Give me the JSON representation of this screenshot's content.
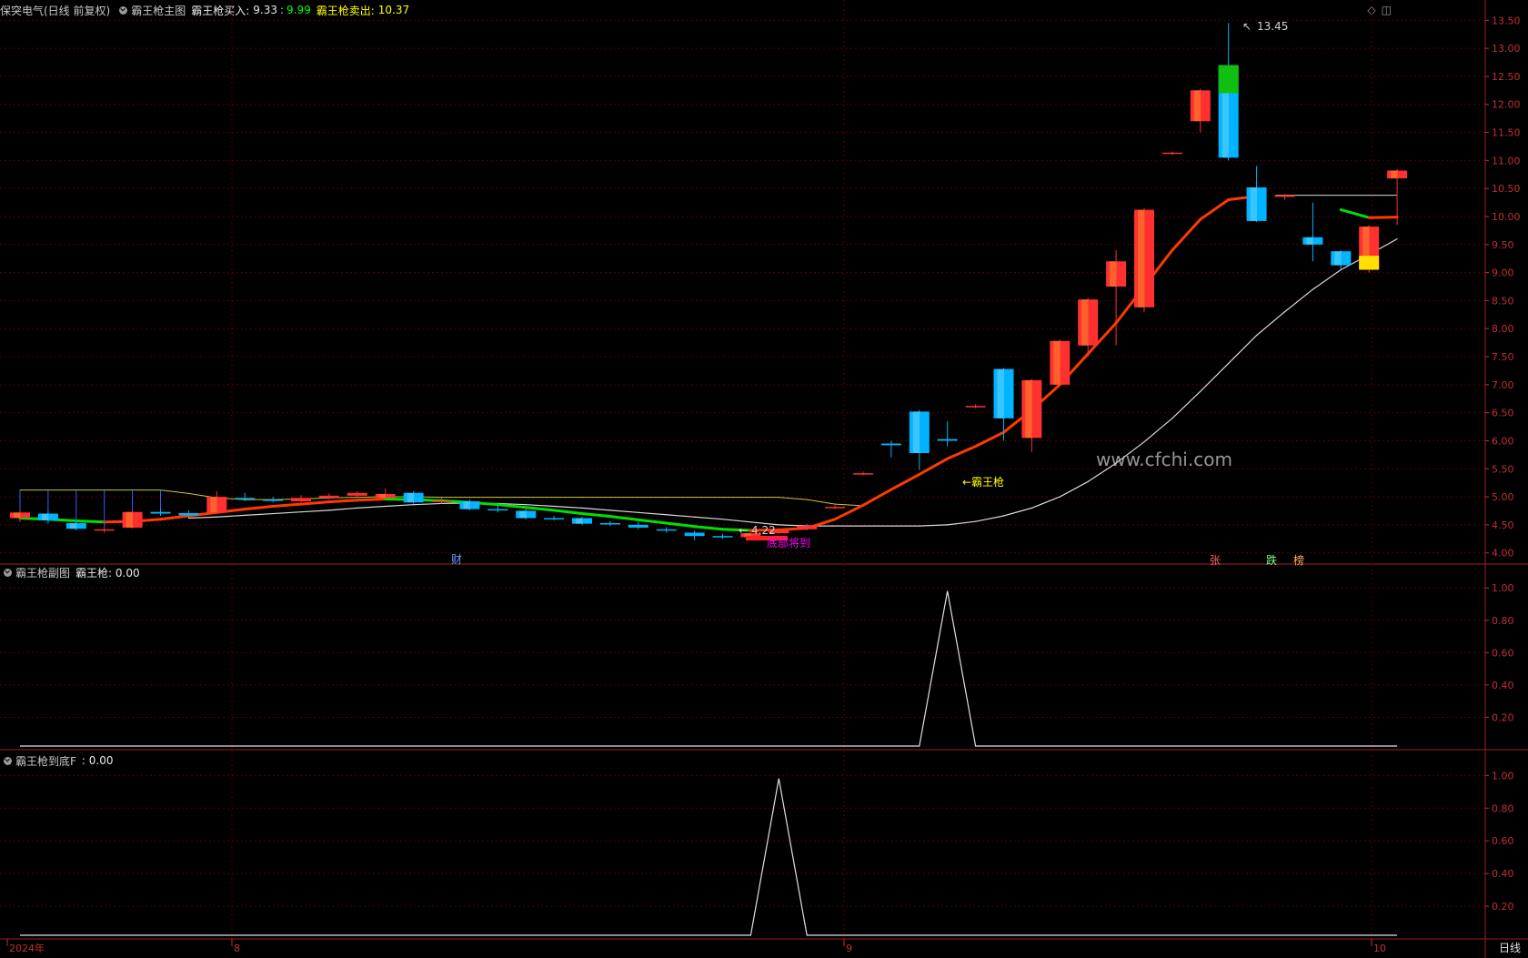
{
  "header": {
    "stock": "保突电气(日线 前复权)",
    "main_indicator": "霸王枪主图",
    "buy_label": "霸王枪买入:",
    "buy_value1": "9.33",
    "buy_value2": "9.99",
    "sell_label": "霸王枪卖出:",
    "sell_value": "10.37"
  },
  "panel2": {
    "indicator": "霸王枪副图",
    "value_label": "霸王枪: 0.00"
  },
  "panel3": {
    "indicator": "霸王枪到底F",
    "value_label": ": 0.00"
  },
  "watermark": "www.cfchi.com",
  "annotations": {
    "peak": "13.45",
    "low": "4.22",
    "bawangqiang": "←霸王枪",
    "bottom_signal": "底部将到",
    "cai": "财",
    "zhang": "张",
    "die": "跌",
    "bang": "榜"
  },
  "price_axis": [
    "13.50",
    "13.00",
    "12.50",
    "12.00",
    "11.50",
    "11.00",
    "10.50",
    "10.00",
    "9.50",
    "9.00",
    "8.50",
    "8.00",
    "7.50",
    "7.00",
    "6.50",
    "6.00",
    "5.50",
    "5.00",
    "4.50",
    "4.00"
  ],
  "sub_axis": [
    "1.00",
    "0.80",
    "0.60",
    "0.40",
    "0.20"
  ],
  "date_axis": [
    "2024年",
    "8",
    "9",
    "10"
  ],
  "period_button": "日线",
  "colors": {
    "up": "#ff3030",
    "down": "#00b4ff",
    "ma_up": "#ff3a00",
    "ma_down": "#00e000",
    "grid": "#5a0000",
    "axis": "#c03030"
  },
  "chart_data": [
    {
      "type": "candlestick",
      "title": "霸王枪主图",
      "ylim": [
        3.8,
        13.7
      ],
      "candles": [
        {
          "o": 4.62,
          "c": 4.72,
          "h": 4.75,
          "l": 4.55
        },
        {
          "o": 4.7,
          "c": 4.58,
          "h": 4.76,
          "l": 4.52
        },
        {
          "o": 4.53,
          "c": 4.43,
          "h": 4.56,
          "l": 4.4
        },
        {
          "o": 4.4,
          "c": 4.42,
          "h": 4.45,
          "l": 4.36
        },
        {
          "o": 4.45,
          "c": 4.73,
          "h": 4.76,
          "l": 4.43
        },
        {
          "o": 4.73,
          "c": 4.7,
          "h": 4.78,
          "l": 4.66
        },
        {
          "o": 4.71,
          "c": 4.67,
          "h": 4.76,
          "l": 4.64
        },
        {
          "o": 4.72,
          "c": 5.0,
          "h": 5.1,
          "l": 4.7
        },
        {
          "o": 4.98,
          "c": 4.96,
          "h": 5.07,
          "l": 4.92
        },
        {
          "o": 4.95,
          "c": 4.93,
          "h": 5.0,
          "l": 4.9
        },
        {
          "o": 4.92,
          "c": 4.98,
          "h": 5.03,
          "l": 4.9
        },
        {
          "o": 4.98,
          "c": 5.02,
          "h": 5.06,
          "l": 4.95
        },
        {
          "o": 5.02,
          "c": 5.07,
          "h": 5.1,
          "l": 4.99
        },
        {
          "o": 4.98,
          "c": 5.05,
          "h": 5.15,
          "l": 4.96
        },
        {
          "o": 5.07,
          "c": 4.9,
          "h": 5.1,
          "l": 4.88
        },
        {
          "o": 4.92,
          "c": 4.93,
          "h": 4.98,
          "l": 4.88
        },
        {
          "o": 4.92,
          "c": 4.78,
          "h": 4.95,
          "l": 4.76
        },
        {
          "o": 4.78,
          "c": 4.77,
          "h": 4.85,
          "l": 4.72
        },
        {
          "o": 4.75,
          "c": 4.62,
          "h": 4.78,
          "l": 4.6
        },
        {
          "o": 4.62,
          "c": 4.6,
          "h": 4.66,
          "l": 4.58
        },
        {
          "o": 4.62,
          "c": 4.52,
          "h": 4.64,
          "l": 4.5
        },
        {
          "o": 4.53,
          "c": 4.52,
          "h": 4.57,
          "l": 4.48
        },
        {
          "o": 4.5,
          "c": 4.45,
          "h": 4.55,
          "l": 4.42
        },
        {
          "o": 4.42,
          "c": 4.4,
          "h": 4.46,
          "l": 4.36
        },
        {
          "o": 4.36,
          "c": 4.3,
          "h": 4.4,
          "l": 4.22
        },
        {
          "o": 4.3,
          "c": 4.29,
          "h": 4.34,
          "l": 4.25
        },
        {
          "o": 4.28,
          "c": 4.35,
          "h": 4.37,
          "l": 4.26
        },
        {
          "o": 4.35,
          "c": 4.4,
          "h": 4.43,
          "l": 4.34
        },
        {
          "o": 4.42,
          "c": 4.48,
          "h": 4.52,
          "l": 4.4
        },
        {
          "o": 4.8,
          "c": 4.82,
          "h": 4.85,
          "l": 4.78
        },
        {
          "o": 5.4,
          "c": 5.42,
          "h": 5.45,
          "l": 5.38
        },
        {
          "o": 5.95,
          "c": 5.92,
          "h": 6.0,
          "l": 5.7
        },
        {
          "o": 6.52,
          "c": 5.78,
          "h": 6.55,
          "l": 5.48
        },
        {
          "o": 6.03,
          "c": 6.0,
          "h": 6.35,
          "l": 5.9
        },
        {
          "o": 6.6,
          "c": 6.62,
          "h": 6.65,
          "l": 6.58
        },
        {
          "o": 7.28,
          "c": 6.4,
          "h": 7.3,
          "l": 6.0
        },
        {
          "o": 6.05,
          "c": 7.08,
          "h": 7.1,
          "l": 5.8
        },
        {
          "o": 7.0,
          "c": 7.78,
          "h": 7.8,
          "l": 6.98
        },
        {
          "o": 7.7,
          "c": 8.52,
          "h": 8.55,
          "l": 7.5
        },
        {
          "o": 8.75,
          "c": 9.2,
          "h": 9.4,
          "l": 7.7
        },
        {
          "o": 8.38,
          "c": 10.12,
          "h": 10.15,
          "l": 8.3
        },
        {
          "o": 11.12,
          "c": 11.14,
          "h": 11.16,
          "l": 11.1
        },
        {
          "o": 11.7,
          "c": 12.25,
          "h": 12.28,
          "l": 11.5
        },
        {
          "o": 12.7,
          "c": 11.05,
          "h": 13.45,
          "l": 11.0
        },
        {
          "o": 10.52,
          "c": 9.92,
          "h": 10.9,
          "l": 9.9
        },
        {
          "o": 10.35,
          "c": 10.38,
          "h": 10.4,
          "l": 10.3
        },
        {
          "o": 9.63,
          "c": 9.5,
          "h": 10.25,
          "l": 9.2
        },
        {
          "o": 9.38,
          "c": 9.13,
          "h": 9.4,
          "l": 9.05
        },
        {
          "o": 9.05,
          "c": 9.82,
          "h": 9.85,
          "l": 9.0
        },
        {
          "o": 10.68,
          "c": 10.82,
          "h": 10.85,
          "l": 9.85
        }
      ],
      "ma_red_green": [
        4.62,
        4.6,
        4.57,
        4.55,
        4.56,
        4.6,
        4.66,
        4.72,
        4.78,
        4.83,
        4.87,
        4.91,
        4.94,
        4.96,
        4.95,
        4.93,
        4.9,
        4.86,
        4.81,
        4.76,
        4.7,
        4.65,
        4.59,
        4.53,
        4.47,
        4.42,
        4.4,
        4.41,
        4.44,
        4.6,
        4.85,
        5.13,
        5.4,
        5.68,
        5.9,
        6.15,
        6.55,
        7.0,
        7.55,
        8.1,
        8.75,
        9.4,
        9.95,
        10.3,
        10.36,
        null,
        null,
        10.12,
        9.98,
        9.99
      ],
      "ma_white": [
        null,
        null,
        null,
        null,
        null,
        null,
        4.62,
        4.64,
        4.67,
        4.7,
        4.73,
        4.76,
        4.8,
        4.83,
        4.86,
        4.88,
        4.89,
        4.88,
        4.86,
        4.83,
        4.8,
        4.76,
        4.72,
        4.68,
        4.64,
        4.6,
        4.55,
        4.5,
        4.48,
        4.48,
        4.48,
        4.48,
        4.48,
        4.5,
        4.56,
        4.66,
        4.8,
        5.0,
        5.27,
        5.6,
        5.98,
        6.4,
        6.88,
        7.38,
        7.88,
        8.3,
        8.7,
        9.05,
        9.32,
        9.6
      ],
      "ma_yellow": [
        5.12,
        5.12,
        5.12,
        5.12,
        5.12,
        5.12,
        5.06,
        4.98,
        4.95,
        4.95,
        4.96,
        4.98,
        4.99,
        5.0,
        5.0,
        4.99,
        4.99,
        4.99,
        4.99,
        4.99,
        4.99,
        4.99,
        4.99,
        4.99,
        4.99,
        4.99,
        4.99,
        4.99,
        4.95,
        4.87,
        4.84
      ]
    },
    {
      "type": "line",
      "title": "霸王枪副图",
      "ylim": [
        0,
        1.05
      ],
      "values": [
        0,
        0,
        0,
        0,
        0,
        0,
        0,
        0,
        0,
        0,
        0,
        0,
        0,
        0,
        0,
        0,
        0,
        0,
        0,
        0,
        0,
        0,
        0,
        0,
        0,
        0,
        0,
        0,
        0,
        0,
        0,
        0,
        0,
        1,
        0,
        0,
        0,
        0,
        0,
        0,
        0,
        0,
        0,
        0,
        0,
        0,
        0,
        0,
        0,
        0
      ]
    },
    {
      "type": "line",
      "title": "霸王枪到底F",
      "ylim": [
        0,
        1.05
      ],
      "values": [
        0,
        0,
        0,
        0,
        0,
        0,
        0,
        0,
        0,
        0,
        0,
        0,
        0,
        0,
        0,
        0,
        0,
        0,
        0,
        0,
        0,
        0,
        0,
        0,
        0,
        0,
        0,
        1,
        0,
        0,
        0,
        0,
        0,
        0,
        0,
        0,
        0,
        0,
        0,
        0,
        0,
        0,
        0,
        0,
        0,
        0,
        0,
        0,
        0,
        0
      ]
    }
  ]
}
